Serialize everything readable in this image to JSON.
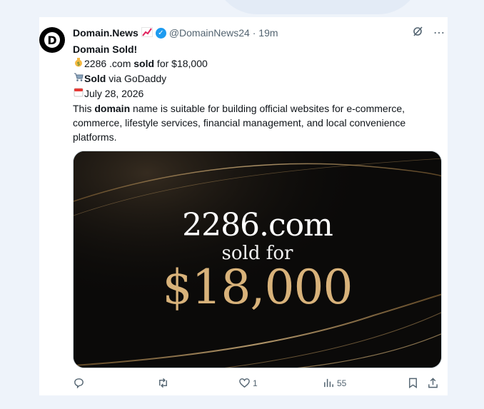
{
  "tweet": {
    "display_name": "Domain.News",
    "handle_time": "@DomainNews24 · 19m",
    "line1": "Domain  Sold!",
    "line2_pre": "2286 .com ",
    "line2_bold": "sold",
    "line2_post": " for $18,000",
    "line3_bold": "Sold",
    "line3_post": " via  GoDaddy",
    "line4": "July 28, 2026",
    "body_pre": "This ",
    "body_bold": "domain",
    "body_post": " name is suitable for building official websites for e-commerce, commerce, lifestyle services, financial management, and local convenience platforms."
  },
  "media": {
    "domain": "2286.com",
    "subtitle": "sold for",
    "price": "$18,000"
  },
  "actions": {
    "replies": "",
    "retweets": "",
    "likes": "1",
    "views": "55"
  },
  "icons": {
    "avatar": "domain-news-logo",
    "trend": "chart-increasing-icon",
    "verified": "verified-badge-icon",
    "grok": "grok-icon",
    "more": "more-icon",
    "money": "money-bag-icon",
    "cart": "shopping-cart-icon",
    "calendar": "calendar-icon"
  },
  "colors": {
    "accent": "#1d9bf0",
    "gold": "#d8b27a",
    "background": "#eef3fa"
  }
}
